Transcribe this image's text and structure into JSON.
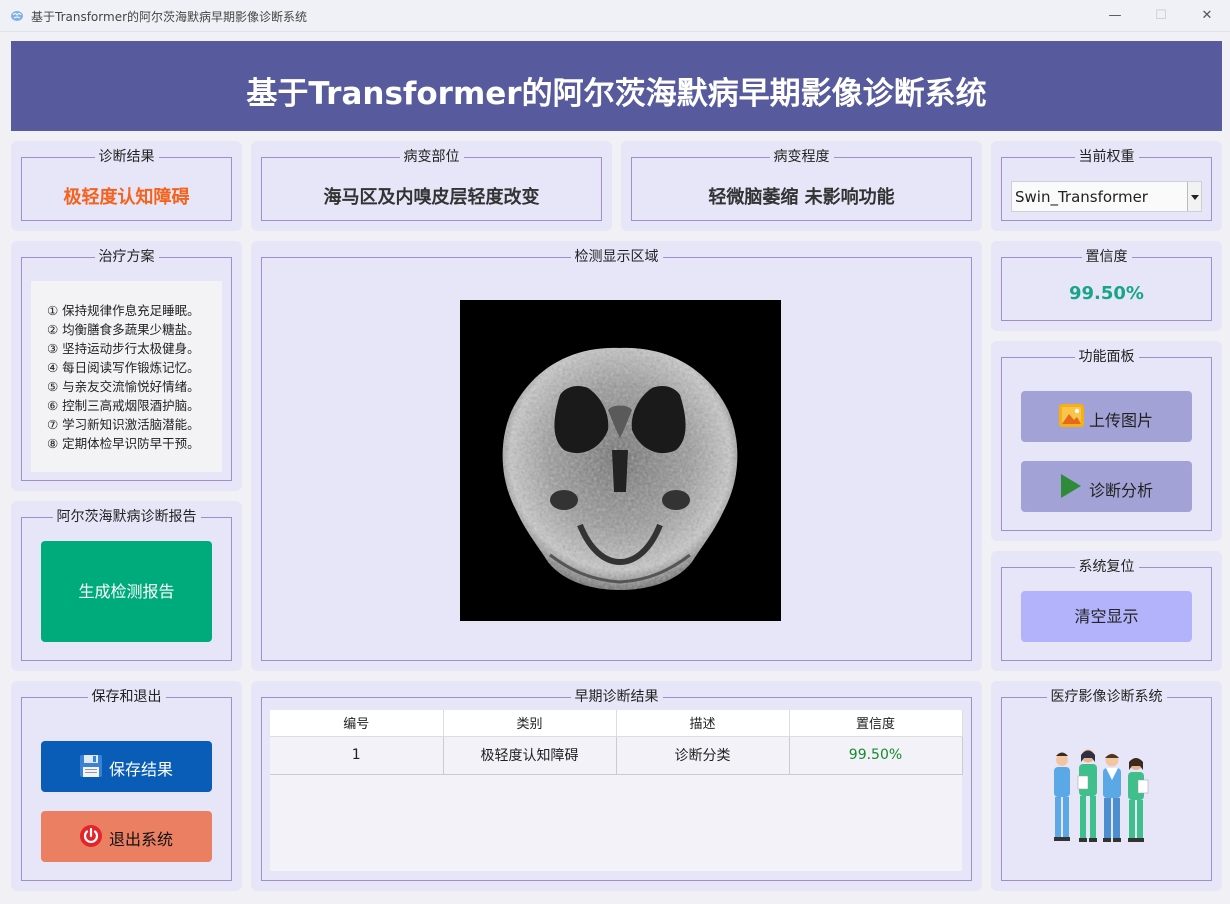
{
  "window": {
    "title": "基于Transformer的阿尔茨海默病早期影像诊断系统",
    "minimize": "—",
    "maximize": "☐",
    "close": "✕"
  },
  "header": {
    "title": "基于Transformer的阿尔茨海默病早期影像诊断系统"
  },
  "diagnosis": {
    "label": "诊断结果",
    "value": "极轻度认知障碍",
    "color": "#f5621c"
  },
  "lesion_site": {
    "label": "病变部位",
    "value": "海马区及内嗅皮层轻度改变"
  },
  "lesion_degree": {
    "label": "病变程度",
    "value": "轻微脑萎缩 未影响功能"
  },
  "weights": {
    "label": "当前权重",
    "selected": "Swin_Transformer"
  },
  "treatment": {
    "label": "治疗方案",
    "items": [
      "① 保持规律作息充足睡眠。",
      "② 均衡膳食多蔬果少糖盐。",
      "③ 坚持运动步行太极健身。",
      "④ 每日阅读写作锻炼记忆。",
      "⑤ 与亲友交流愉悦好情绪。",
      "⑥ 控制三高戒烟限酒护脑。",
      "⑦ 学习新知识激活脑潜能。",
      "⑧ 定期体检早识防早干预。"
    ]
  },
  "report": {
    "label": "阿尔茨海默病诊断报告",
    "button": "生成检测报告",
    "button_color": "#00ab7b"
  },
  "display": {
    "label": "检测显示区域"
  },
  "confidence": {
    "label": "置信度",
    "value": "99.50%",
    "color": "#17a589"
  },
  "functions": {
    "label": "功能面板",
    "upload": "上传图片",
    "analyze": "诊断分析",
    "button_color": "#a2a2d6"
  },
  "reset": {
    "label": "系统复位",
    "button": "清空显示",
    "button_color": "#b3b3fb"
  },
  "save_exit": {
    "label": "保存和退出",
    "save": "保存结果",
    "save_color": "#0a5db6",
    "exit": "退出系统",
    "exit_color": "#eb7f62"
  },
  "early_results": {
    "label": "早期诊断结果",
    "columns": [
      "编号",
      "类别",
      "描述",
      "置信度"
    ],
    "rows": [
      {
        "id": "1",
        "category": "极轻度认知障碍",
        "description": "诊断分类",
        "confidence": "99.50%"
      }
    ],
    "confidence_color": "#168a2c"
  },
  "brand": {
    "label": "医疗影像诊断系统"
  }
}
